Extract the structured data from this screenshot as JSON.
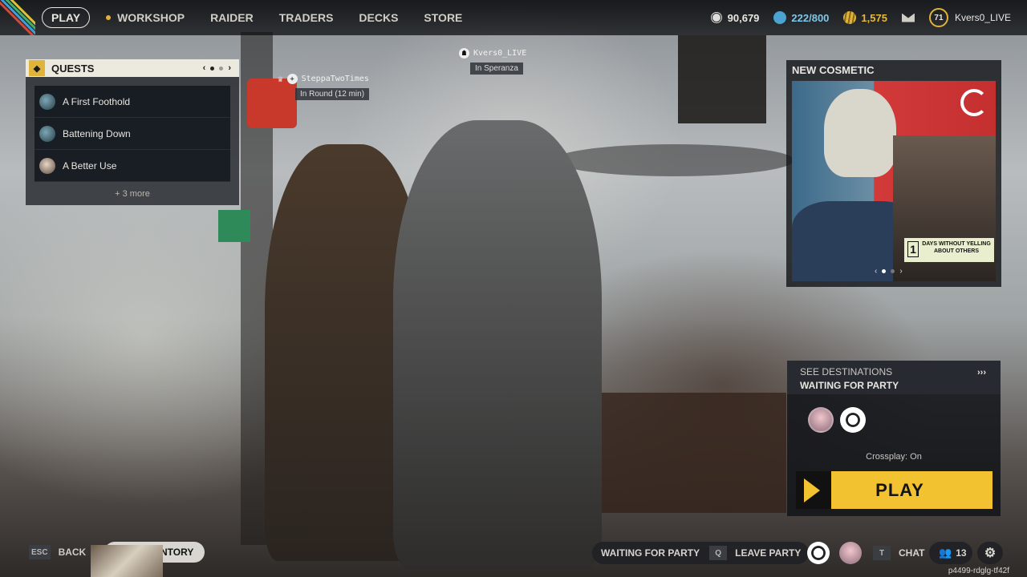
{
  "nav": {
    "play": "PLAY",
    "items": [
      "WORKSHOP",
      "RAIDER",
      "TRADERS",
      "DECKS",
      "STORE"
    ],
    "workshop_notification": true
  },
  "currencies": {
    "coins": "90,679",
    "cred": "222/800",
    "tokens": "1,575"
  },
  "user": {
    "level": "71",
    "name": "Kvers0_LIVE"
  },
  "quests": {
    "title": "QUESTS",
    "items": [
      {
        "label": "A First Foothold"
      },
      {
        "label": "Battening Down"
      },
      {
        "label": "A Better Use"
      }
    ],
    "more": "+ 3 more"
  },
  "tags": {
    "self": {
      "name": "Kvers0_LIVE",
      "status": "In Speranza"
    },
    "friend": {
      "name": "SteppaTwoTimes",
      "status": "In Round (12 min)"
    }
  },
  "cosmetic": {
    "title": "NEW COSMETIC",
    "sticker_number": "1",
    "sticker_text": "DAYS WITHOUT YELLING ABOUT OTHERS"
  },
  "party": {
    "destinations": "SEE DESTINATIONS",
    "status": "WAITING FOR PARTY",
    "crossplay": "Crossplay: On",
    "play": "PLAY"
  },
  "bottom": {
    "back_key": "ESC",
    "back": "BACK",
    "inventory": "NTORY",
    "waiting": "WAITING FOR PARTY",
    "leave_key": "Q",
    "leave": "LEAVE PARTY",
    "chat_key": "T",
    "chat": "CHAT",
    "friends_count": "13"
  },
  "session_id": "p4499-rdglg-tf42f",
  "colors": {
    "accent": "#f2c230",
    "panel": "#14161a"
  }
}
